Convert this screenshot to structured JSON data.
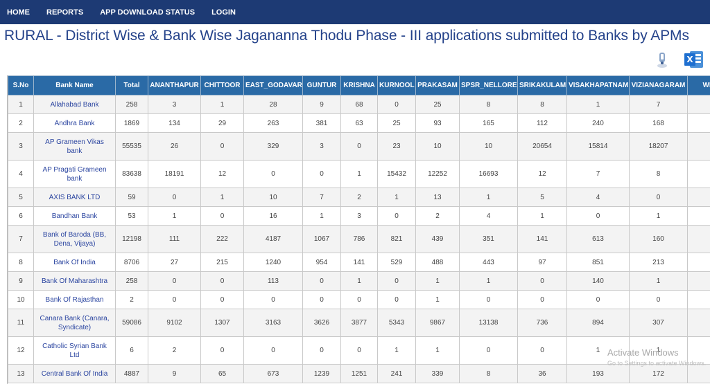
{
  "nav": {
    "items": [
      "HOME",
      "REPORTS",
      "APP DOWNLOAD STATUS",
      "LOGIN"
    ]
  },
  "page": {
    "title": "RURAL - District Wise & Bank Wise Jagananna Thodu Phase - III applications submitted to Banks by APMs"
  },
  "icons": {
    "print": "print-icon",
    "excel": "excel-icon"
  },
  "table": {
    "headers": [
      "S.No",
      "Bank Name",
      "Total",
      "ANANTHAPUR",
      "CHITTOOR",
      "EAST_GODAVARI",
      "GUNTUR",
      "KRISHNA",
      "KURNOOL",
      "PRAKASAM",
      "SPSR_NELLORE",
      "SRIKAKULAM",
      "VISAKHAPATNAM",
      "VIZIANAGARAM",
      "WE"
    ],
    "rows": [
      [
        "1",
        "Allahabad Bank",
        "258",
        "3",
        "1",
        "28",
        "9",
        "68",
        "0",
        "25",
        "8",
        "8",
        "1",
        "7"
      ],
      [
        "2",
        "Andhra Bank",
        "1869",
        "134",
        "29",
        "263",
        "381",
        "63",
        "25",
        "93",
        "165",
        "112",
        "240",
        "168"
      ],
      [
        "3",
        "AP Grameen Vikas bank",
        "55535",
        "26",
        "0",
        "329",
        "3",
        "0",
        "23",
        "10",
        "10",
        "20654",
        "15814",
        "18207"
      ],
      [
        "4",
        "AP Pragati Grameen bank",
        "83638",
        "18191",
        "12",
        "0",
        "0",
        "1",
        "15432",
        "12252",
        "16693",
        "12",
        "7",
        "8"
      ],
      [
        "5",
        "AXIS BANK LTD",
        "59",
        "0",
        "1",
        "10",
        "7",
        "2",
        "1",
        "13",
        "1",
        "5",
        "4",
        "0"
      ],
      [
        "6",
        "Bandhan Bank",
        "53",
        "1",
        "0",
        "16",
        "1",
        "3",
        "0",
        "2",
        "4",
        "1",
        "0",
        "1"
      ],
      [
        "7",
        "Bank of Baroda (BB, Dena, Vijaya)",
        "12198",
        "111",
        "222",
        "4187",
        "1067",
        "786",
        "821",
        "439",
        "351",
        "141",
        "613",
        "160"
      ],
      [
        "8",
        "Bank Of India",
        "8706",
        "27",
        "215",
        "1240",
        "954",
        "141",
        "529",
        "488",
        "443",
        "97",
        "851",
        "213"
      ],
      [
        "9",
        "Bank Of Maharashtra",
        "258",
        "0",
        "0",
        "113",
        "0",
        "1",
        "0",
        "1",
        "1",
        "0",
        "140",
        "1"
      ],
      [
        "10",
        "Bank Of Rajasthan",
        "2",
        "0",
        "0",
        "0",
        "0",
        "0",
        "0",
        "1",
        "0",
        "0",
        "0",
        "0"
      ],
      [
        "11",
        "Canara Bank (Canara, Syndicate)",
        "59086",
        "9102",
        "1307",
        "3163",
        "3626",
        "3877",
        "5343",
        "9867",
        "13138",
        "736",
        "894",
        "307"
      ],
      [
        "12",
        "Catholic Syrian Bank Ltd",
        "6",
        "2",
        "0",
        "0",
        "0",
        "0",
        "1",
        "1",
        "0",
        "0",
        "1",
        "1"
      ],
      [
        "13",
        "Central Bank Of India",
        "4887",
        "9",
        "65",
        "673",
        "1239",
        "1251",
        "241",
        "339",
        "8",
        "36",
        "193",
        "172"
      ]
    ]
  },
  "watermark": {
    "title": "Activate Windows",
    "subtitle": "Go to Settings to activate Windows."
  }
}
